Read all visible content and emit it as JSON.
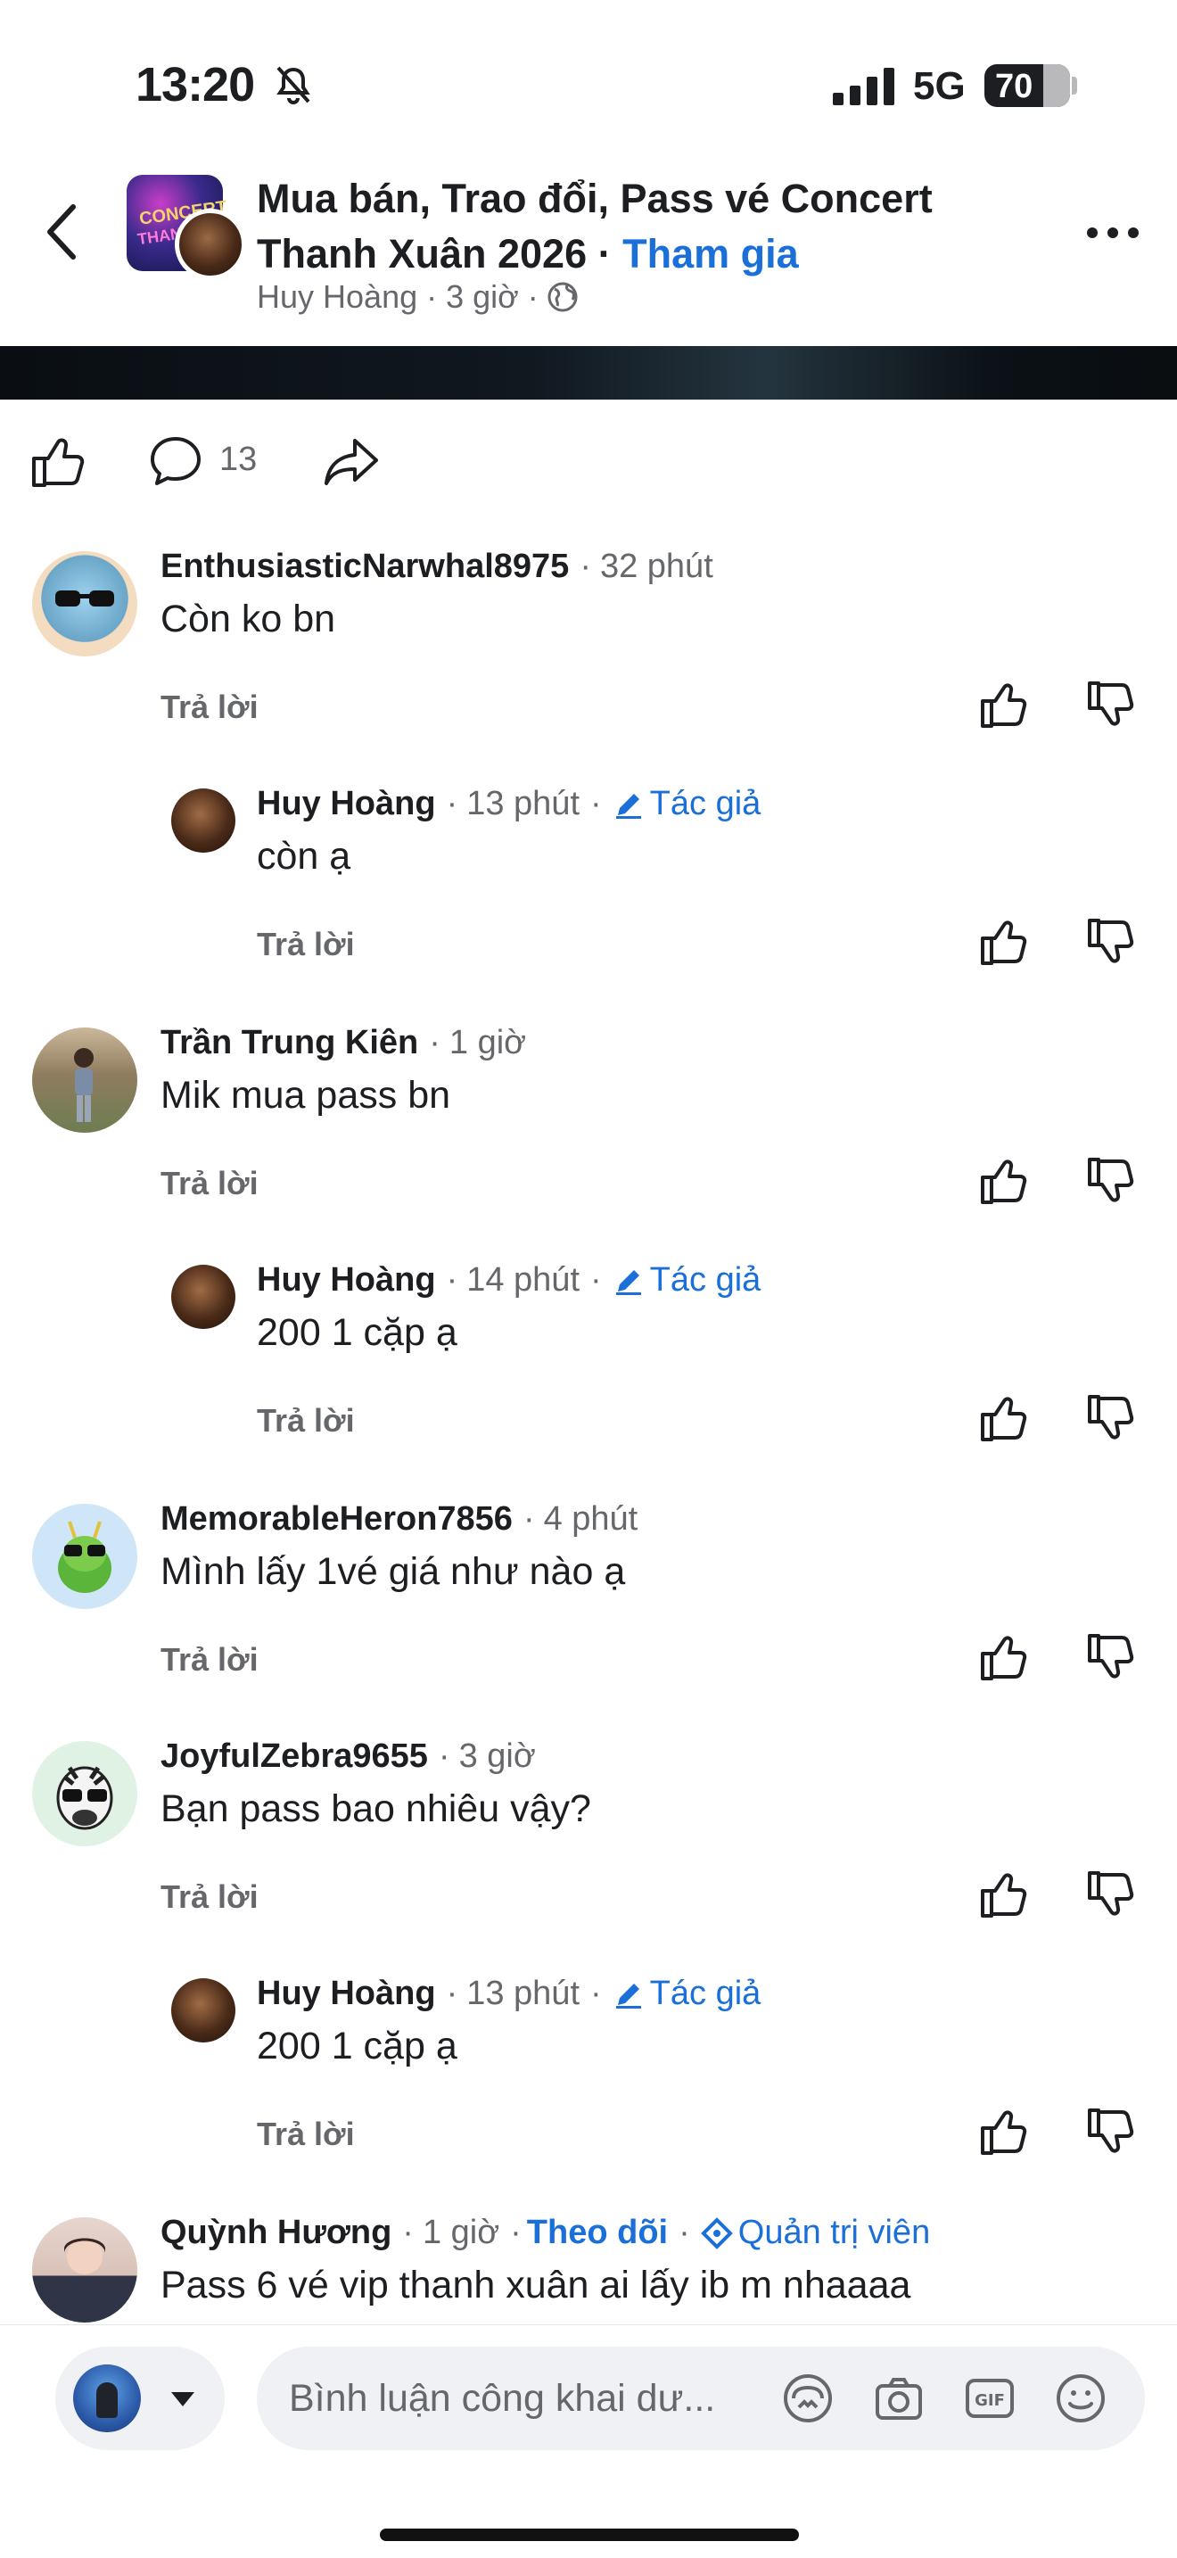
{
  "status_bar": {
    "time": "13:20",
    "network": "5G",
    "battery": "70"
  },
  "post_header": {
    "group_name": "Mua bán, Trao đổi, Pass vé Concert Thanh Xuân 2026",
    "separator": " · ",
    "join_label": "Tham gia",
    "author": "Huy Hoàng",
    "posted": "3 giờ"
  },
  "action_bar": {
    "comment_count": "13"
  },
  "labels": {
    "reply": "Trả lời",
    "author_badge": "Tác giả",
    "admin_badge": "Quản trị viên",
    "follow": "Theo dõi"
  },
  "comments": [
    {
      "name": "EnthusiasticNarwhal8975",
      "time": "32 phút",
      "text": "Còn ko bn",
      "reply_label": "Trả lời"
    },
    {
      "name": "Huy Hoàng",
      "time": "13 phút",
      "badge": "Tác giả",
      "text": "còn ạ",
      "reply_label": "Trả lời"
    },
    {
      "name": "Trần Trung Kiên",
      "time": "1 giờ",
      "text": "Mik mua pass bn",
      "reply_label": "Trả lời"
    },
    {
      "name": "Huy Hoàng",
      "time": "14 phút",
      "badge": "Tác giả",
      "text": "200 1 cặp ạ",
      "reply_label": "Trả lời"
    },
    {
      "name": "MemorableHeron7856",
      "time": "4 phút",
      "text": "Mình lấy 1vé giá như nào ạ",
      "reply_label": "Trả lời"
    },
    {
      "name": "JoyfulZebra9655",
      "time": "3 giờ",
      "text": "Bạn pass bao nhiêu vậy?",
      "reply_label": "Trả lời"
    },
    {
      "name": "Huy Hoàng",
      "time": "13 phút",
      "badge": "Tác giả",
      "text": "200 1 cặp ạ",
      "reply_label": "Trả lời"
    },
    {
      "name": "Quỳnh Hương",
      "time": "1 giờ",
      "follow": "Theo dõi",
      "badge": "Quản trị viên",
      "text": "Pass 6 vé vip thanh xuân ai lấy ib m nhaaaa"
    }
  ],
  "composer": {
    "placeholder": "Bình luận công khai dư..."
  },
  "colors": {
    "link_blue": "#1b6fd8",
    "meta_gray": "#65676b",
    "input_bg": "#eff1f4"
  },
  "icons": [
    "back-arrow",
    "more-dots",
    "like",
    "comment",
    "share",
    "upvote",
    "downvote",
    "pencil",
    "admin-diamond",
    "avatar-sticker",
    "camera",
    "gif",
    "emoji",
    "caret-down"
  ]
}
